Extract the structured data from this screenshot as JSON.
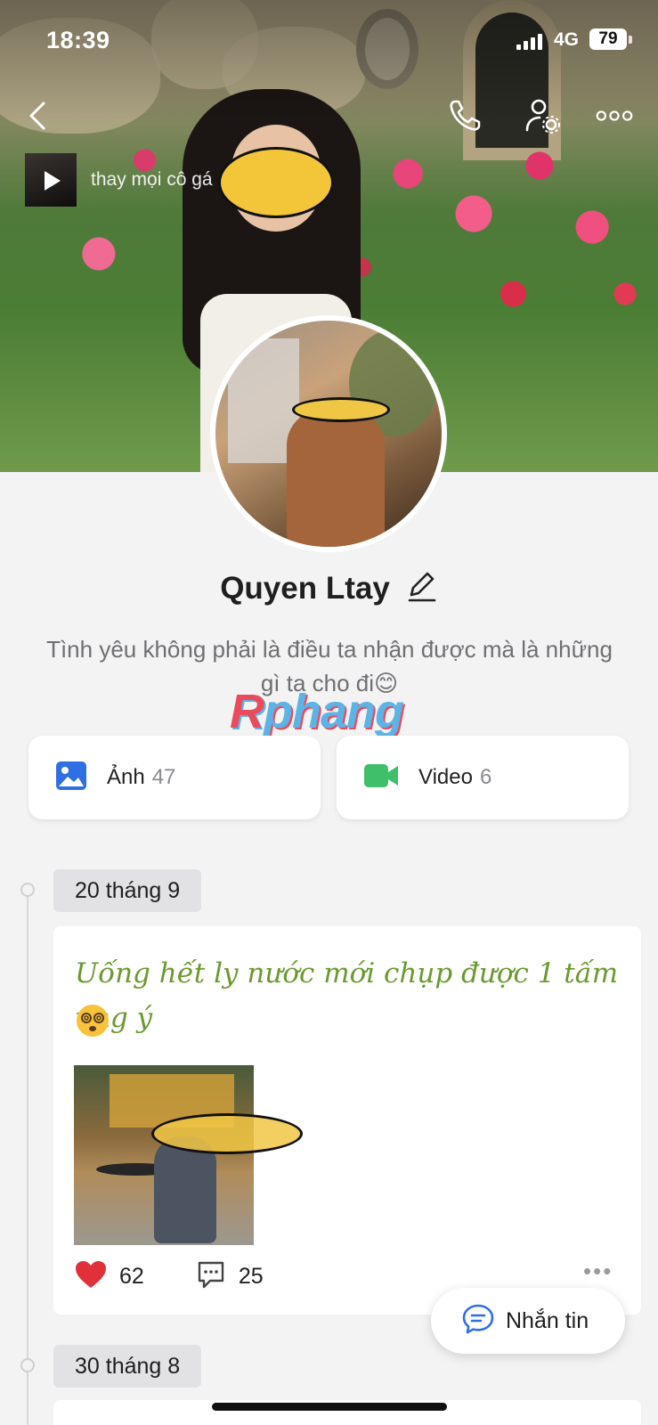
{
  "status_bar": {
    "time": "18:39",
    "network": "4G",
    "battery": "79"
  },
  "cover": {
    "music_title": "thay mọi cô gá"
  },
  "profile": {
    "name": "Quyen Ltay",
    "bio": "Tình yêu không phải là điều ta nhận được mà là những gì ta cho đi😊",
    "watermark": "Rphang"
  },
  "media": {
    "photos": {
      "label": "Ảnh",
      "count": "47"
    },
    "videos": {
      "label": "Video",
      "count": "6"
    }
  },
  "timeline": [
    {
      "date": "20 tháng 9",
      "caption": "Uống hết ly nước mới chụp được 1 tấm ưng ý",
      "emoji": "😵‍💫",
      "likes": "62",
      "comments": "25"
    },
    {
      "date": "30 tháng 8"
    }
  ],
  "fab": {
    "label": "Nhắn tin"
  },
  "colors": {
    "accent_blue": "#2f6fe4",
    "video_green": "#3fbf6a",
    "like_red": "#e0303a",
    "caption_green": "#6a9a2e"
  }
}
